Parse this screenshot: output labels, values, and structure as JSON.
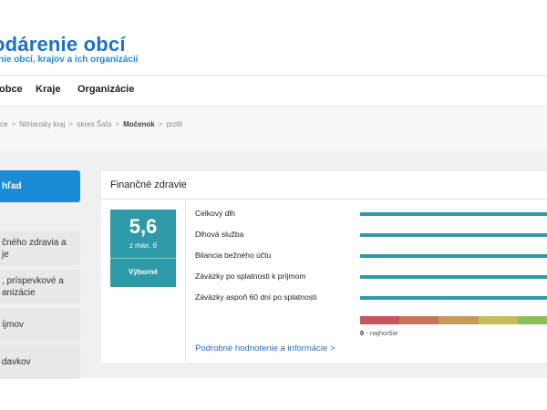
{
  "header": {
    "title": "odárenie obcí",
    "subtitle": "nie obcí, krajov a ich organizácií"
  },
  "nav": {
    "items": [
      {
        "label": "obce"
      },
      {
        "label": "Kraje"
      },
      {
        "label": "Organizácie"
      }
    ]
  },
  "breadcrumb": {
    "items": [
      "ce",
      "Nitriansky kraj",
      "okres Šaľa",
      "Močenok",
      "profil"
    ],
    "separator": ">"
  },
  "sidebar": {
    "items": [
      {
        "label": "hľad",
        "active": true
      },
      {
        "label": "čného zdravia a\nje",
        "active": false
      },
      {
        "label": ", príspevkové a\nanizácie",
        "active": false
      },
      {
        "label": "íjmov",
        "active": false
      },
      {
        "label": "davkov",
        "active": false
      }
    ]
  },
  "card": {
    "title": "Finančné zdravie",
    "score": {
      "value": "5,6",
      "max": "z max. 6",
      "label": "Výborné",
      "color": "#2e9aa8"
    },
    "metrics": [
      {
        "label": "Celkový dlh"
      },
      {
        "label": "Dlhová služba"
      },
      {
        "label": "Bilancia bežného účtu"
      },
      {
        "label": "Záväzky po splatnosti k príjmom"
      },
      {
        "label": "Záväzky aspoň 60 dní po splatnosti"
      }
    ],
    "scale": {
      "colors": [
        "#c9545c",
        "#c9745a",
        "#c89a5a",
        "#c4bd58",
        "#8cbf5a"
      ],
      "caption_value": "0",
      "caption_text": " - najhoršie"
    },
    "detail_link": "Podrobné hodnotenie a informácie  >"
  },
  "colors": {
    "brand": "#1f6fc9",
    "accent": "#1b8bd8",
    "teal": "#2e9aa8"
  }
}
